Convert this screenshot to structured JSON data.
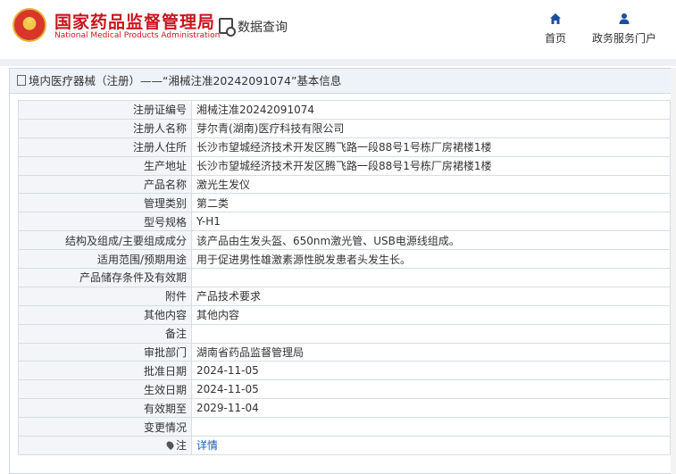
{
  "header": {
    "title_cn": "国家药品监督管理局",
    "title_en": "National Medical Products Administration",
    "query_label": "数据查询"
  },
  "nav": {
    "home_label": "首页",
    "service_label": "政务服务门户"
  },
  "panel": {
    "heading": "境内医疗器械（注册）——“湘械注准20242091074”基本信息"
  },
  "rows": [
    {
      "key": "注册证编号",
      "value": "湘械注准20242091074"
    },
    {
      "key": "注册人名称",
      "value": "芽尔青(湖南)医疗科技有限公司"
    },
    {
      "key": "注册人住所",
      "value": "长沙市望城经济技术开发区腾飞路一段88号1号栋厂房裙楼1楼"
    },
    {
      "key": "生产地址",
      "value": "长沙市望城经济技术开发区腾飞路一段88号1号栋厂房裙楼1楼"
    },
    {
      "key": "产品名称",
      "value": "激光生发仪"
    },
    {
      "key": "管理类别",
      "value": "第二类"
    },
    {
      "key": "型号规格",
      "value": "Y-H1"
    },
    {
      "key": "结构及组成/主要组成成分",
      "value": "该产品由生发头盔、650nm激光管、USB电源线组成。"
    },
    {
      "key": "适用范围/预期用途",
      "value": "用于促进男性雄激素源性脱发患者头发生长。"
    },
    {
      "key": "产品储存条件及有效期",
      "value": ""
    },
    {
      "key": "附件",
      "value": "产品技术要求"
    },
    {
      "key": "其他内容",
      "value": "其他内容"
    },
    {
      "key": "备注",
      "value": ""
    },
    {
      "key": "审批部门",
      "value": "湖南省药品监督管理局"
    },
    {
      "key": "批准日期",
      "value": "2024-11-05"
    },
    {
      "key": "生效日期",
      "value": "2024-11-05"
    },
    {
      "key": "有效期至",
      "value": "2029-11-04"
    },
    {
      "key": "变更情况",
      "value": ""
    }
  ],
  "note": {
    "key": "注",
    "link": "详情"
  }
}
